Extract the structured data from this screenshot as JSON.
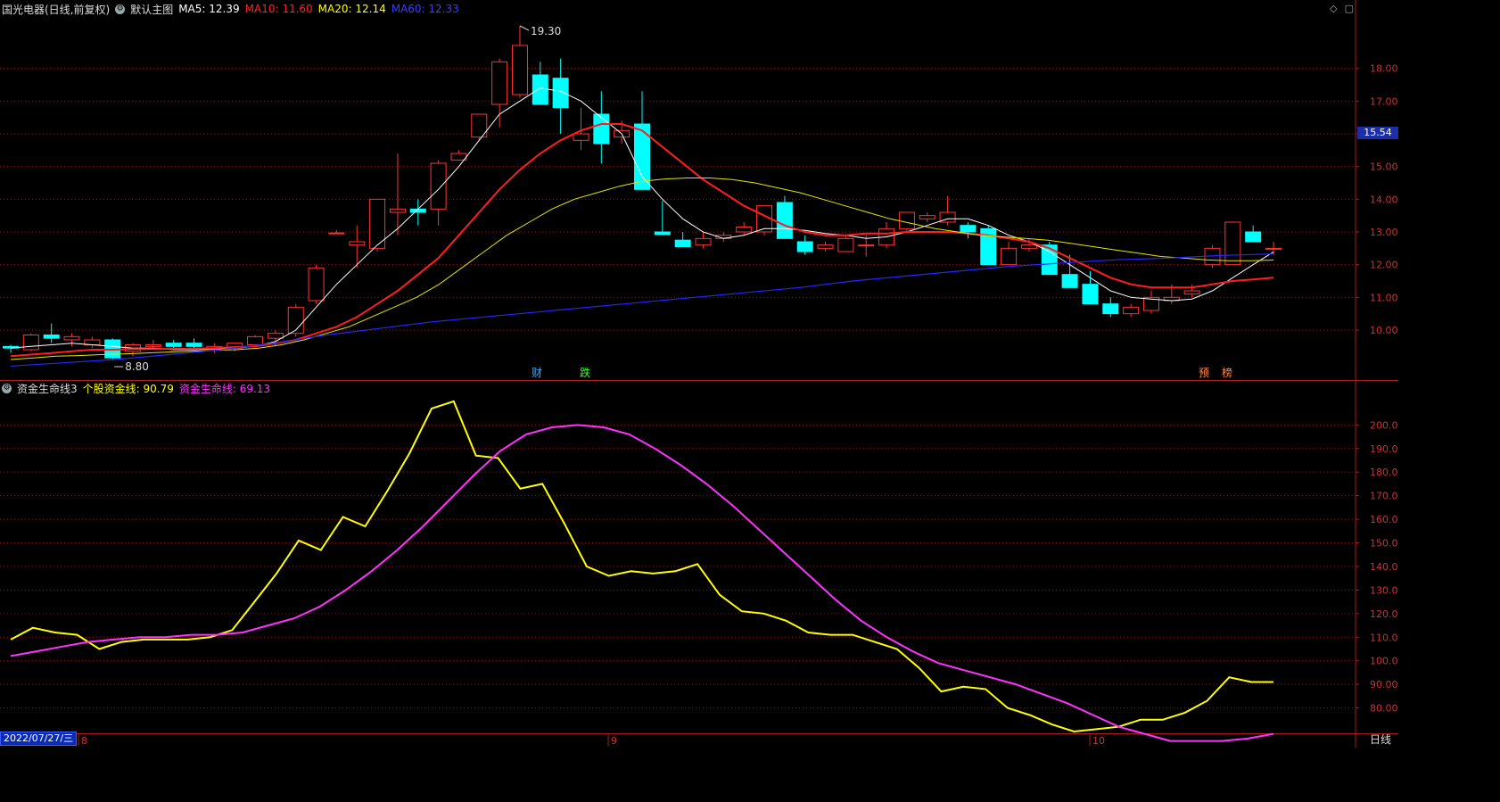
{
  "stock_header": {
    "title": "国光电器(日线,前复权)",
    "indicator_name": "默认主图",
    "ma5": {
      "label": "MA5: 12.39",
      "color": "#ffffff"
    },
    "ma10": {
      "label": "MA10: 11.60",
      "color": "#ff2020"
    },
    "ma20": {
      "label": "MA20: 12.14",
      "color": "#ffff00"
    },
    "ma60": {
      "label": "MA60: 12.33",
      "color": "#2a2aff"
    }
  },
  "sub_header": {
    "indicator_name": "资金生命线3",
    "stock_fund": {
      "label": "个股资金线: 90.79",
      "color": "#ffff00"
    },
    "life_line": {
      "label": "资金生命线: 69.13",
      "color": "#ff33ff"
    }
  },
  "window_icons": {
    "diamond": "◇",
    "square": "▢"
  },
  "current_price": "15.54",
  "high_mark": "19.30",
  "low_mark": "8.80",
  "price_axis": [
    "18.00",
    "17.00",
    "16.00",
    "15.00",
    "14.00",
    "13.00",
    "12.00",
    "11.00",
    "10.00"
  ],
  "sub_axis": [
    "200.0",
    "190.0",
    "180.0",
    "170.0",
    "160.0",
    "150.0",
    "140.0",
    "130.0",
    "120.0",
    "110.0",
    "100.0",
    "90.00",
    "80.00"
  ],
  "date_axis": {
    "current": "2022/07/27/三",
    "months": [
      "8",
      "9",
      "10"
    ]
  },
  "event_markers": [
    {
      "text": "财",
      "color": "#33aaff"
    },
    {
      "text": "跌",
      "color": "#33ff33"
    },
    {
      "text": "预",
      "color": "#ff8844"
    },
    {
      "text": "榜",
      "color": "#ff8844"
    }
  ],
  "period_button": "日线",
  "colors": {
    "up": "#ff3232",
    "down": "#00ffff",
    "ma5": "#ffffff",
    "ma10": "#ff1e1e",
    "ma20": "#e6e600",
    "ma60": "#2626ff",
    "fund": "#ffff00",
    "life": "#ff33ff",
    "grid": "#8a1a1a",
    "frame": "#aa1e1e"
  },
  "chart_data": [
    {
      "type": "candlestick",
      "title": "国光电器(日线,前复权)",
      "y_range": [
        8.5,
        19.6
      ],
      "ohlc": [
        [
          9.5,
          9.55,
          9.3,
          9.45
        ],
        [
          9.4,
          9.9,
          9.35,
          9.85
        ],
        [
          9.85,
          10.2,
          9.6,
          9.75
        ],
        [
          9.7,
          9.9,
          9.5,
          9.8
        ],
        [
          9.55,
          9.8,
          9.45,
          9.7
        ],
        [
          9.7,
          9.75,
          9.1,
          9.15
        ],
        [
          9.35,
          9.6,
          9.2,
          9.55
        ],
        [
          9.5,
          9.7,
          9.4,
          9.55
        ],
        [
          9.6,
          9.7,
          9.4,
          9.5
        ],
        [
          9.6,
          9.75,
          9.45,
          9.5
        ],
        [
          9.45,
          9.6,
          9.3,
          9.5
        ],
        [
          9.45,
          9.6,
          9.35,
          9.6
        ],
        [
          9.55,
          9.85,
          9.5,
          9.8
        ],
        [
          9.75,
          10.0,
          9.5,
          9.9
        ],
        [
          9.9,
          10.8,
          9.8,
          10.7
        ],
        [
          10.9,
          12.0,
          10.8,
          11.9
        ],
        [
          12.95,
          13.05,
          12.95,
          12.97
        ],
        [
          12.6,
          13.2,
          11.9,
          12.7
        ],
        [
          12.5,
          14.0,
          12.4,
          14.0
        ],
        [
          13.6,
          15.4,
          12.9,
          13.7
        ],
        [
          13.7,
          14.0,
          13.2,
          13.6
        ],
        [
          13.7,
          15.2,
          13.2,
          15.1
        ],
        [
          15.2,
          15.5,
          15.2,
          15.4
        ],
        [
          15.9,
          16.6,
          15.8,
          16.6
        ],
        [
          16.9,
          18.3,
          16.2,
          18.2
        ],
        [
          17.2,
          19.3,
          17.1,
          18.7
        ],
        [
          17.8,
          18.2,
          16.9,
          16.9
        ],
        [
          17.7,
          18.3,
          16.0,
          16.8
        ],
        [
          15.8,
          16.8,
          15.5,
          16.0
        ],
        [
          16.6,
          17.3,
          15.1,
          15.7
        ],
        [
          15.9,
          16.4,
          15.7,
          16.1
        ],
        [
          16.3,
          17.3,
          15.4,
          14.3
        ],
        [
          13.0,
          13.95,
          12.9,
          12.92
        ],
        [
          12.75,
          13.0,
          12.6,
          12.55
        ],
        [
          12.6,
          13.0,
          12.5,
          12.8
        ],
        [
          12.8,
          13.0,
          12.7,
          12.9
        ],
        [
          13.0,
          13.3,
          12.9,
          13.15
        ],
        [
          13.0,
          13.8,
          12.9,
          13.8
        ],
        [
          13.9,
          14.1,
          13.0,
          12.8
        ],
        [
          12.7,
          12.9,
          12.3,
          12.4
        ],
        [
          12.5,
          12.7,
          12.4,
          12.6
        ],
        [
          12.4,
          12.9,
          12.4,
          12.8
        ],
        [
          12.6,
          12.9,
          12.25,
          12.6
        ],
        [
          12.6,
          13.3,
          12.5,
          13.1
        ],
        [
          13.1,
          13.6,
          13.0,
          13.6
        ],
        [
          13.4,
          13.6,
          13.3,
          13.5
        ],
        [
          13.3,
          14.1,
          13.2,
          13.6
        ],
        [
          13.2,
          13.3,
          12.8,
          13.0
        ],
        [
          13.1,
          13.2,
          12.5,
          12.0
        ],
        [
          12.0,
          12.7,
          12.0,
          12.5
        ],
        [
          12.5,
          12.8,
          12.4,
          12.6
        ],
        [
          12.6,
          12.7,
          11.7,
          11.7
        ],
        [
          11.7,
          12.3,
          11.3,
          11.3
        ],
        [
          11.4,
          11.8,
          10.8,
          10.8
        ],
        [
          10.8,
          11.0,
          10.4,
          10.5
        ],
        [
          10.5,
          10.8,
          10.4,
          10.7
        ],
        [
          10.6,
          11.2,
          10.5,
          11.0
        ],
        [
          10.9,
          11.4,
          10.8,
          11.0
        ],
        [
          11.1,
          11.4,
          11.0,
          11.2
        ],
        [
          12.0,
          12.6,
          11.9,
          12.5
        ],
        [
          12.0,
          13.3,
          12.0,
          13.3
        ],
        [
          13.0,
          13.2,
          12.7,
          12.7
        ],
        [
          12.5,
          12.7,
          12.3,
          12.5
        ]
      ],
      "series": [
        {
          "name": "MA5",
          "values": [
            9.45,
            9.5,
            9.55,
            9.6,
            9.55,
            9.5,
            9.45,
            9.45,
            9.4,
            9.4,
            9.42,
            9.45,
            9.5,
            9.65,
            10.0,
            10.7,
            11.4,
            12.0,
            12.6,
            13.1,
            13.7,
            14.3,
            15.0,
            15.8,
            16.6,
            17.0,
            17.4,
            17.3,
            17.0,
            16.5,
            16.0,
            14.7,
            14.0,
            13.4,
            13.0,
            12.8,
            12.9,
            13.1,
            13.1,
            13.05,
            12.95,
            12.9,
            12.8,
            12.85,
            13.0,
            13.2,
            13.4,
            13.4,
            13.2,
            12.9,
            12.7,
            12.4,
            12.0,
            11.6,
            11.2,
            11.0,
            10.95,
            10.9,
            10.95,
            11.2,
            11.6,
            12.0,
            12.39
          ]
        },
        {
          "name": "MA10",
          "values": [
            9.2,
            9.25,
            9.3,
            9.35,
            9.4,
            9.4,
            9.42,
            9.42,
            9.43,
            9.43,
            9.45,
            9.48,
            9.5,
            9.6,
            9.7,
            9.9,
            10.1,
            10.4,
            10.8,
            11.2,
            11.7,
            12.2,
            12.9,
            13.6,
            14.3,
            14.9,
            15.4,
            15.8,
            16.1,
            16.3,
            16.3,
            16.1,
            15.6,
            15.1,
            14.6,
            14.2,
            13.8,
            13.5,
            13.2,
            13.0,
            12.9,
            12.9,
            12.95,
            12.95,
            13.0,
            13.0,
            13.0,
            12.95,
            12.9,
            12.8,
            12.7,
            12.5,
            12.2,
            11.9,
            11.6,
            11.4,
            11.3,
            11.3,
            11.3,
            11.4,
            11.5,
            11.55,
            11.6
          ]
        },
        {
          "name": "MA20",
          "values": [
            9.1,
            9.15,
            9.2,
            9.22,
            9.25,
            9.27,
            9.3,
            9.33,
            9.35,
            9.38,
            9.4,
            9.45,
            9.55,
            9.7,
            9.9,
            10.1,
            10.4,
            10.7,
            11.0,
            11.4,
            11.9,
            12.4,
            12.9,
            13.3,
            13.7,
            14.0,
            14.2,
            14.4,
            14.55,
            14.62,
            14.65,
            14.65,
            14.6,
            14.5,
            14.35,
            14.2,
            14.0,
            13.8,
            13.6,
            13.4,
            13.25,
            13.1,
            13.0,
            12.9,
            12.85,
            12.8,
            12.75,
            12.65,
            12.55,
            12.45,
            12.35,
            12.25,
            12.2,
            12.15,
            12.12,
            12.12,
            12.14
          ]
        },
        {
          "name": "MA60",
          "values": [
            8.9,
            9.0,
            9.1,
            9.25,
            9.4,
            9.6,
            9.85,
            10.05,
            10.25,
            10.4,
            10.55,
            10.7,
            10.85,
            11.0,
            11.15,
            11.3,
            11.5,
            11.65,
            11.8,
            11.95,
            12.05,
            12.15,
            12.2,
            12.28,
            12.33
          ]
        }
      ]
    },
    {
      "type": "line",
      "title": "资金生命线3",
      "y_range": [
        70,
        213
      ],
      "series": [
        {
          "name": "个股资金线",
          "values": [
            109,
            114,
            112,
            111,
            105,
            108,
            109,
            109,
            109,
            110,
            113,
            125,
            137,
            151,
            147,
            161,
            157,
            172,
            188,
            207,
            210,
            187,
            186,
            173,
            175,
            158,
            140,
            136,
            138,
            137,
            138,
            141,
            128,
            121,
            120,
            117,
            112,
            111,
            111,
            108,
            105,
            97,
            87,
            89,
            88,
            80,
            77,
            73,
            70,
            71,
            72,
            75,
            75,
            78,
            83,
            93,
            91,
            91
          ]
        },
        {
          "name": "资金生命线",
          "values": [
            102,
            104,
            106,
            108,
            109,
            110,
            110,
            111,
            111,
            112,
            115,
            118,
            123,
            130,
            138,
            147,
            157,
            168,
            179,
            189,
            196,
            199,
            200,
            199,
            196,
            190,
            183,
            175,
            166,
            156,
            146,
            136,
            126,
            117,
            110,
            104,
            99,
            96,
            93,
            90,
            86,
            82,
            77,
            72,
            69,
            66,
            66,
            66,
            67,
            69
          ]
        }
      ]
    }
  ]
}
